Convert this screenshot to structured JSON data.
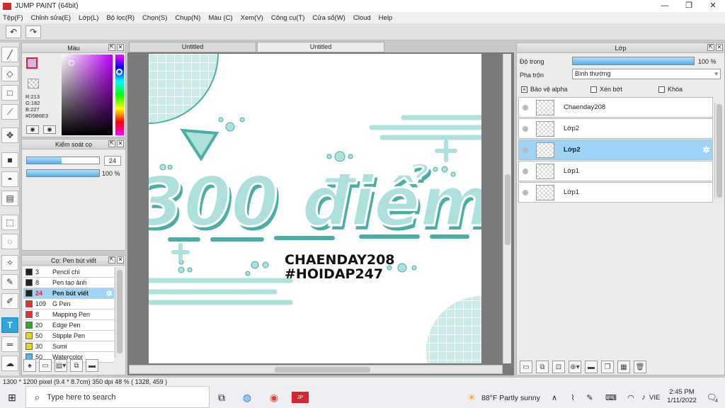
{
  "window": {
    "title": "JUMP PAINT (64bit)",
    "min": "—",
    "max": "❐",
    "close": "✕"
  },
  "menu": [
    "Tệp(F)",
    "Chỉnh sửa(E)",
    "Lớp(L)",
    "Bộ lọc(R)",
    "Chọn(S)",
    "Chụp(N)",
    "Màu (C)",
    "Xem(V)",
    "Công cụ(T)",
    "Cửa sổ(W)",
    "Cloud",
    "Help"
  ],
  "toolbar": {
    "undo_icon": "↶",
    "redo_icon": "↷"
  },
  "color_panel": {
    "title": "Màu",
    "rgb": {
      "r": "R:213",
      "g": "G:182",
      "b": "B:227",
      "hex": "#D5B6E3"
    },
    "current_color": "#D5B6E3"
  },
  "brush_control": {
    "title": "Kiểm soát cọ",
    "size": "24",
    "size_fraction": 0.48,
    "opacity": "100 %",
    "opacity_fraction": 1.0
  },
  "brush_list": {
    "title": "Cọ: Pen bút viết",
    "items": [
      {
        "size": "3",
        "name": "Pencil chì",
        "color": "#222222"
      },
      {
        "size": "8",
        "name": "Pen tạo ảnh",
        "color": "#222222"
      },
      {
        "size": "24",
        "name": "Pen bút viết",
        "color": "#222222",
        "selected": true
      },
      {
        "size": "109",
        "name": "G Pen",
        "color": "#e53030"
      },
      {
        "size": "8",
        "name": "Mapping Pen",
        "color": "#e53030"
      },
      {
        "size": "20",
        "name": "Edge Pen",
        "color": "#2aa830"
      },
      {
        "size": "50",
        "name": "Stipple Pen",
        "color": "#e8d21e"
      },
      {
        "size": "30",
        "name": "Sumi",
        "color": "#e8d21e"
      },
      {
        "size": "50",
        "name": "Watercolor",
        "color": "#59b4e8"
      }
    ]
  },
  "doc_tabs": [
    "Untitled",
    "Untitled"
  ],
  "canvas": {
    "line1": "CHAENDAY208",
    "line2": "#HOIDAP247",
    "headline": "300 điểm",
    "accent": "#aee0dd",
    "shadow": "#4aaea5"
  },
  "layer_panel": {
    "title": "Lớp",
    "opacity_label": "Độ trong",
    "opacity_value": "100 %",
    "opacity_fraction": 1.0,
    "blend_label": "Pha trộn",
    "blend_value": "Bình thường",
    "protect_alpha": "Bảo vệ alpha",
    "clip": "Xén bớt",
    "lock": "Khóa",
    "layers": [
      {
        "name": "Chaenday208"
      },
      {
        "name": "Lớp2"
      },
      {
        "name": "Lớp2",
        "selected": true
      },
      {
        "name": "Lớp1"
      },
      {
        "name": "Lớp1"
      }
    ]
  },
  "status": "1300 * 1200 pixel  (9.4 * 8.7cm)  350 dpi  48 %  ( 1328, 459 )",
  "taskbar": {
    "search_placeholder": "Type here to search",
    "weather": "88°F  Partly sunny",
    "lang": "VIE",
    "time": "2:45 PM",
    "date": "1/11/2022",
    "notifications": "4"
  }
}
